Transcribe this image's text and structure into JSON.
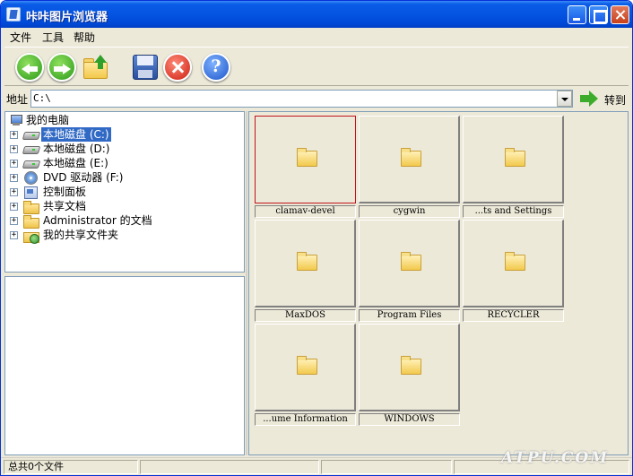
{
  "window": {
    "title": "咔咔图片浏览器"
  },
  "menu": [
    "文件",
    "工具",
    "帮助"
  ],
  "toolbar": {
    "icons": [
      "back-icon",
      "forward-icon",
      "up-folder-icon",
      "save-icon",
      "stop-icon",
      "help-icon"
    ],
    "help_glyph": "?"
  },
  "address": {
    "label": "地址",
    "value": "C:\\",
    "go_label": "转到"
  },
  "tree": [
    {
      "label": "我的电脑",
      "icon": "computer-icon",
      "level": 0,
      "selected": false
    },
    {
      "label": "本地磁盘 (C:)",
      "icon": "drive-icon",
      "level": 1,
      "selected": true
    },
    {
      "label": "本地磁盘 (D:)",
      "icon": "drive-icon",
      "level": 1,
      "selected": false
    },
    {
      "label": "本地磁盘 (E:)",
      "icon": "drive-icon",
      "level": 1,
      "selected": false
    },
    {
      "label": "DVD 驱动器 (F:)",
      "icon": "dvd-icon",
      "level": 1,
      "selected": false
    },
    {
      "label": "控制面板",
      "icon": "control-panel-icon",
      "level": 1,
      "selected": false
    },
    {
      "label": "共享文档",
      "icon": "folder-icon",
      "level": 1,
      "selected": false
    },
    {
      "label": "Administrator 的文档",
      "icon": "folder-icon",
      "level": 1,
      "selected": false
    },
    {
      "label": "我的共享文件夹",
      "icon": "shared-folder-icon",
      "level": 1,
      "selected": false
    }
  ],
  "expander_glyph": "+",
  "thumbnails": [
    {
      "caption": "clamav-devel",
      "selected": true
    },
    {
      "caption": "cygwin",
      "selected": false
    },
    {
      "caption": "...ts and Settings",
      "selected": false
    },
    {
      "caption": "MaxDOS",
      "selected": false
    },
    {
      "caption": "Program Files",
      "selected": false
    },
    {
      "caption": "RECYCLER",
      "selected": false
    },
    {
      "caption": "...ume Information",
      "selected": false
    },
    {
      "caption": "WINDOWS",
      "selected": false
    }
  ],
  "status": {
    "count_text": "总共0个文件"
  },
  "watermark": "ATPU.COM",
  "colors": {
    "title_bar": "#0554e2",
    "selection": "#316ac5",
    "selected_thumb_border": "#c0141c"
  }
}
